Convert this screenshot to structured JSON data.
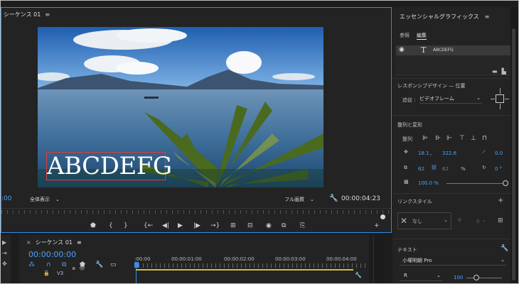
{
  "monitor": {
    "tab_label": "シーケンス 01",
    "menu_glyph": "≡",
    "title_overlay": "ABCDEFG",
    "timecode_current": ":00",
    "zoom_label": "全体表示",
    "quality_label": "フル画質",
    "timecode_duration": "00:00:04:23",
    "chevron": "⌄"
  },
  "timeline": {
    "close_glyph": "×",
    "tab_label": "シーケンス 01",
    "menu_glyph": "≡",
    "timecode": "00:00:00:00",
    "track_label": "V3",
    "ruler_times": [
      ":00:00",
      "00:00:01:00",
      "00:00:02:00",
      "00:00:03:00",
      "00:00:04:00"
    ]
  },
  "eg": {
    "title": "エッセンシャルグラフィックス",
    "menu_glyph": "≡",
    "tabs": {
      "browse": "参照",
      "edit": "編集"
    },
    "layer_icon": "T",
    "layer_name": "ABCDEFG",
    "responsive": {
      "heading": "レスポンシブデザイン — 位置",
      "pin_label": "追従 :",
      "pin_value": "ビデオフレーム"
    },
    "align": {
      "heading": "整列と変形",
      "align_label": "整列",
      "pos_x": "18.1",
      "pos_y": "322.6",
      "rotation": "0.0",
      "scale_w": "62",
      "scale_h": "62",
      "percent": "%",
      "angle": "0 °",
      "opacity": "100.0 %",
      "opacity_level": 1.0
    },
    "master_style": {
      "heading": "リンクスタイル",
      "value": "なし",
      "count": "0"
    },
    "text": {
      "heading": "テキスト",
      "font": "小塚明朝 Pro",
      "style": "R",
      "size": "100"
    }
  },
  "colors": {
    "accent": "#2d8ceb",
    "timecode_blue": "#4aa3ff",
    "selection_red": "#e23a3a",
    "panel_bg": "#232323",
    "work_area": "#d7b93a"
  }
}
